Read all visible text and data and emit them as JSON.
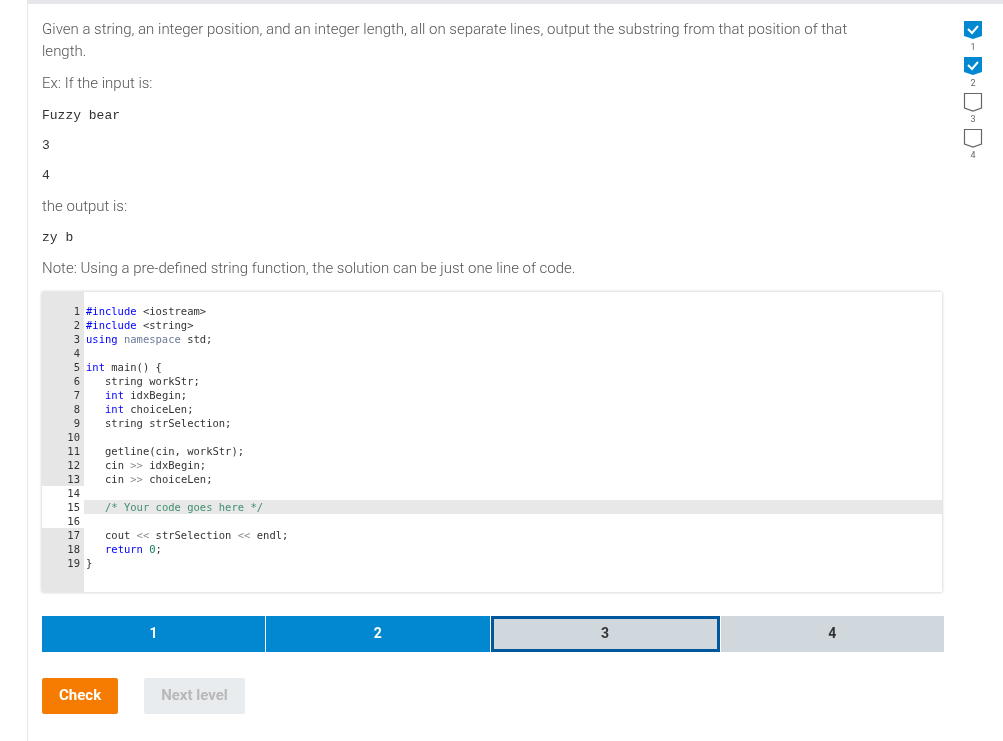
{
  "prompt": "Given a string, an integer position, and an integer length, all on separate lines, output the substring from that position of that length.",
  "example_intro": "Ex: If the input is:",
  "input_lines": [
    "Fuzzy bear",
    "3",
    "4"
  ],
  "output_intro": "the output is:",
  "output_lines": [
    "zy b"
  ],
  "note": "Note: Using a pre-defined string function, the solution can be just one line of code.",
  "code": [
    {
      "number": "1",
      "active": false,
      "editable": false,
      "indented": false,
      "segments": [
        {
          "kind": "kw",
          "text": "#include"
        },
        {
          "kind": "plain",
          "text": " <iostream>"
        }
      ]
    },
    {
      "number": "2",
      "active": false,
      "editable": false,
      "indented": false,
      "segments": [
        {
          "kind": "kw",
          "text": "#include"
        },
        {
          "kind": "plain",
          "text": " <string>"
        }
      ]
    },
    {
      "number": "3",
      "active": false,
      "editable": false,
      "indented": false,
      "segments": [
        {
          "kind": "kw",
          "text": "using"
        },
        {
          "kind": "ns",
          "text": " namespace"
        },
        {
          "kind": "plain",
          "text": " std;"
        }
      ]
    },
    {
      "number": "4",
      "active": false,
      "editable": false
    },
    {
      "number": "5",
      "active": false,
      "editable": false,
      "indented": false,
      "segments": [
        {
          "kind": "kw",
          "text": "int"
        },
        {
          "kind": "plain",
          "text": " main() {"
        }
      ]
    },
    {
      "number": "6",
      "active": false,
      "editable": false,
      "indented": true,
      "segments": [
        {
          "kind": "plain",
          "text": "string workStr;"
        }
      ]
    },
    {
      "number": "7",
      "active": false,
      "editable": false,
      "indented": true,
      "segments": [
        {
          "kind": "kw",
          "text": "int"
        },
        {
          "kind": "plain",
          "text": " idxBegin;"
        }
      ]
    },
    {
      "number": "8",
      "active": false,
      "editable": false,
      "indented": true,
      "segments": [
        {
          "kind": "kw",
          "text": "int"
        },
        {
          "kind": "plain",
          "text": " choiceLen;"
        }
      ]
    },
    {
      "number": "9",
      "active": false,
      "editable": false,
      "indented": true,
      "segments": [
        {
          "kind": "plain",
          "text": "string strSelection;"
        }
      ]
    },
    {
      "number": "10",
      "active": false,
      "editable": false
    },
    {
      "number": "11",
      "active": false,
      "editable": false,
      "indented": true,
      "segments": [
        {
          "kind": "plain",
          "text": "getline(cin, workStr);"
        }
      ]
    },
    {
      "number": "12",
      "active": false,
      "editable": false,
      "indented": true,
      "segments": [
        {
          "kind": "plain",
          "text": "cin "
        },
        {
          "kind": "op",
          "text": ">>"
        },
        {
          "kind": "plain",
          "text": " idxBegin;"
        }
      ]
    },
    {
      "number": "13",
      "active": false,
      "editable": false,
      "indented": true,
      "segments": [
        {
          "kind": "plain",
          "text": "cin "
        },
        {
          "kind": "op",
          "text": ">>"
        },
        {
          "kind": "plain",
          "text": " choiceLen;"
        }
      ]
    },
    {
      "number": "14",
      "active": false,
      "editable": true
    },
    {
      "number": "15",
      "active": true,
      "editable": true,
      "indented": true,
      "segments": [
        {
          "kind": "comment",
          "text": "/* Your code goes here */"
        }
      ]
    },
    {
      "number": "16",
      "active": false,
      "editable": true
    },
    {
      "number": "17",
      "active": false,
      "editable": false,
      "indented": true,
      "segments": [
        {
          "kind": "plain",
          "text": "cout "
        },
        {
          "kind": "op",
          "text": "<<"
        },
        {
          "kind": "plain",
          "text": " strSelection "
        },
        {
          "kind": "op",
          "text": "<<"
        },
        {
          "kind": "plain",
          "text": " endl;"
        }
      ]
    },
    {
      "number": "18",
      "active": false,
      "editable": false,
      "indented": true,
      "segments": [
        {
          "kind": "kw",
          "text": "return"
        },
        {
          "kind": "num",
          "text": " 0"
        },
        {
          "kind": "plain",
          "text": ";"
        }
      ]
    },
    {
      "number": "19",
      "active": false,
      "editable": false,
      "indented": false,
      "segments": [
        {
          "kind": "plain",
          "text": "}"
        }
      ]
    }
  ],
  "levels": [
    {
      "label": "1",
      "completed": true,
      "selected": false
    },
    {
      "label": "2",
      "completed": true,
      "selected": false
    },
    {
      "label": "3",
      "completed": false,
      "selected": true
    },
    {
      "label": "4",
      "completed": false,
      "selected": false
    }
  ],
  "buttons": [
    {
      "label": "Check",
      "disabled": false
    },
    {
      "label": "Next level",
      "disabled": true
    }
  ],
  "progress": [
    {
      "label": "1",
      "checked": true
    },
    {
      "label": "2",
      "checked": true
    },
    {
      "label": "3",
      "checked": false
    },
    {
      "label": "4",
      "checked": false
    }
  ]
}
